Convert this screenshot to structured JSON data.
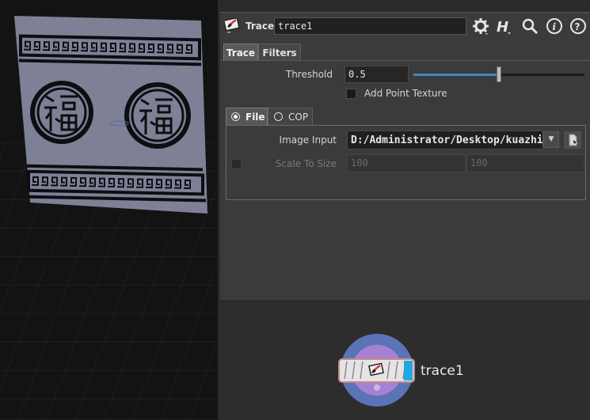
{
  "node": {
    "type_label": "Trace",
    "name": "trace1"
  },
  "header_tools": [
    "gear-icon",
    "houdini-help-icon",
    "search-icon",
    "info-icon",
    "help-icon"
  ],
  "tabs": [
    {
      "label": "Trace",
      "active": true
    },
    {
      "label": "Filters",
      "active": false
    }
  ],
  "params": {
    "threshold": {
      "label": "Threshold",
      "value": "0.5",
      "slider_fraction": 0.5
    },
    "add_point_texture": {
      "label": "Add Point Texture",
      "checked": false
    }
  },
  "source_tabs": [
    {
      "label": "File",
      "selected": true
    },
    {
      "label": "COP",
      "selected": false
    }
  ],
  "file": {
    "image_input": {
      "label": "Image Input",
      "value": "D:/Administrator/Desktop/kuazhi"
    },
    "scale_to_size": {
      "label": "Scale To Size",
      "x": "100",
      "y": "100",
      "enabled": false
    }
  },
  "network": {
    "node_label": "trace1"
  },
  "colors": {
    "slider_fill": "#3f88c5",
    "node_ring": "#5b74b8",
    "node_inner": "#a782d2",
    "node_flag": "#1fa8e4"
  }
}
